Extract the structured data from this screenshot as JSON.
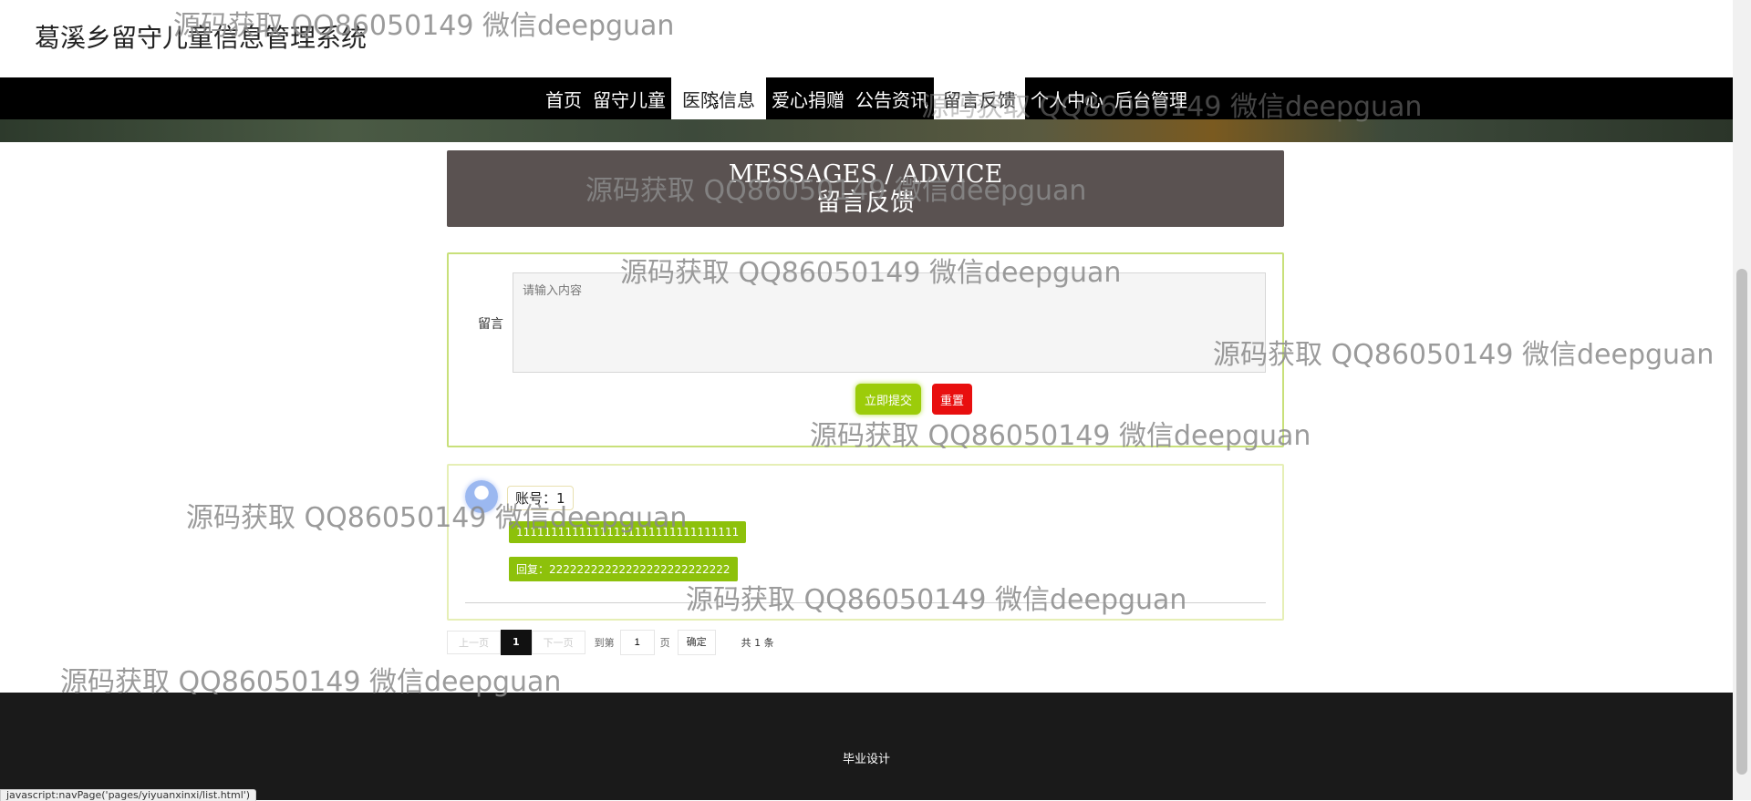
{
  "site": {
    "title": "葛溪乡留守儿童信息管理系统"
  },
  "nav": {
    "items": [
      {
        "label": "首页"
      },
      {
        "label": "留守儿童"
      },
      {
        "label": "医院信息"
      },
      {
        "label": "爱心捐赠"
      },
      {
        "label": "公告资讯"
      },
      {
        "label": "留言反馈"
      },
      {
        "label": "个人中心"
      },
      {
        "label": "后台管理"
      }
    ]
  },
  "page_heading": {
    "en": "MESSAGES / ADVICE",
    "cn": "留言反馈"
  },
  "form": {
    "label": "留言",
    "placeholder": "请输入内容",
    "submit_label": "立即提交",
    "reset_label": "重置"
  },
  "messages": [
    {
      "user": "账号：1",
      "content": "11111111111111111111111111111111",
      "reply": "回复：22222222222222222222222222"
    }
  ],
  "pager": {
    "prev": "上一页",
    "current": "1",
    "next": "下一页",
    "goto_label": "到第",
    "page_input": "1",
    "page_unit": "页",
    "confirm": "确定",
    "total": "共 1 条"
  },
  "footer": {
    "text": "毕业设计"
  },
  "status_bar": {
    "text": "javascript:navPage('pages/yiyuanxinxi/list.html')"
  },
  "watermark": "源码获取 QQ86050149 微信deepguan"
}
